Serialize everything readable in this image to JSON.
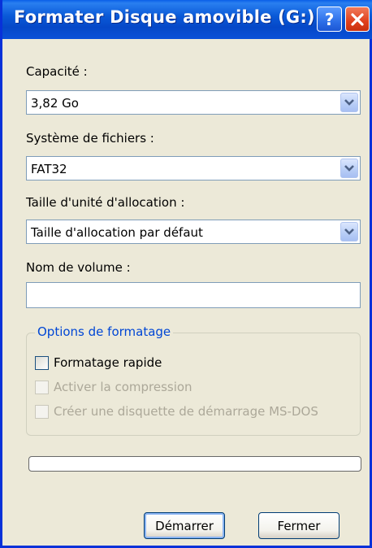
{
  "window": {
    "title": "Formater Disque amovible (G:)",
    "help_label": "?",
    "close_label": "✕"
  },
  "capacity": {
    "label": "Capacité :",
    "value": "3,82 Go"
  },
  "filesystem": {
    "label": "Système de fichiers :",
    "value": "FAT32"
  },
  "allocation": {
    "label": "Taille d'unité d'allocation :",
    "value": "Taille d'allocation par défaut"
  },
  "volume": {
    "label": "Nom de volume :",
    "value": ""
  },
  "options": {
    "legend": "Options de formatage",
    "quick_format": {
      "label": "Formatage rapide",
      "checked": false,
      "enabled": true
    },
    "compression": {
      "label": "Activer la compression",
      "checked": false,
      "enabled": false
    },
    "msdos_disk": {
      "label": "Créer une disquette de démarrage MS-DOS",
      "checked": false,
      "enabled": false
    }
  },
  "progress": {
    "value": 0
  },
  "buttons": {
    "start": "Démarrer",
    "close": "Fermer"
  },
  "colors": {
    "titlebar": "#0a5ad8",
    "dialog_bg": "#ece9d8",
    "group_legend": "#0046d5",
    "close_button": "#e0401c"
  }
}
